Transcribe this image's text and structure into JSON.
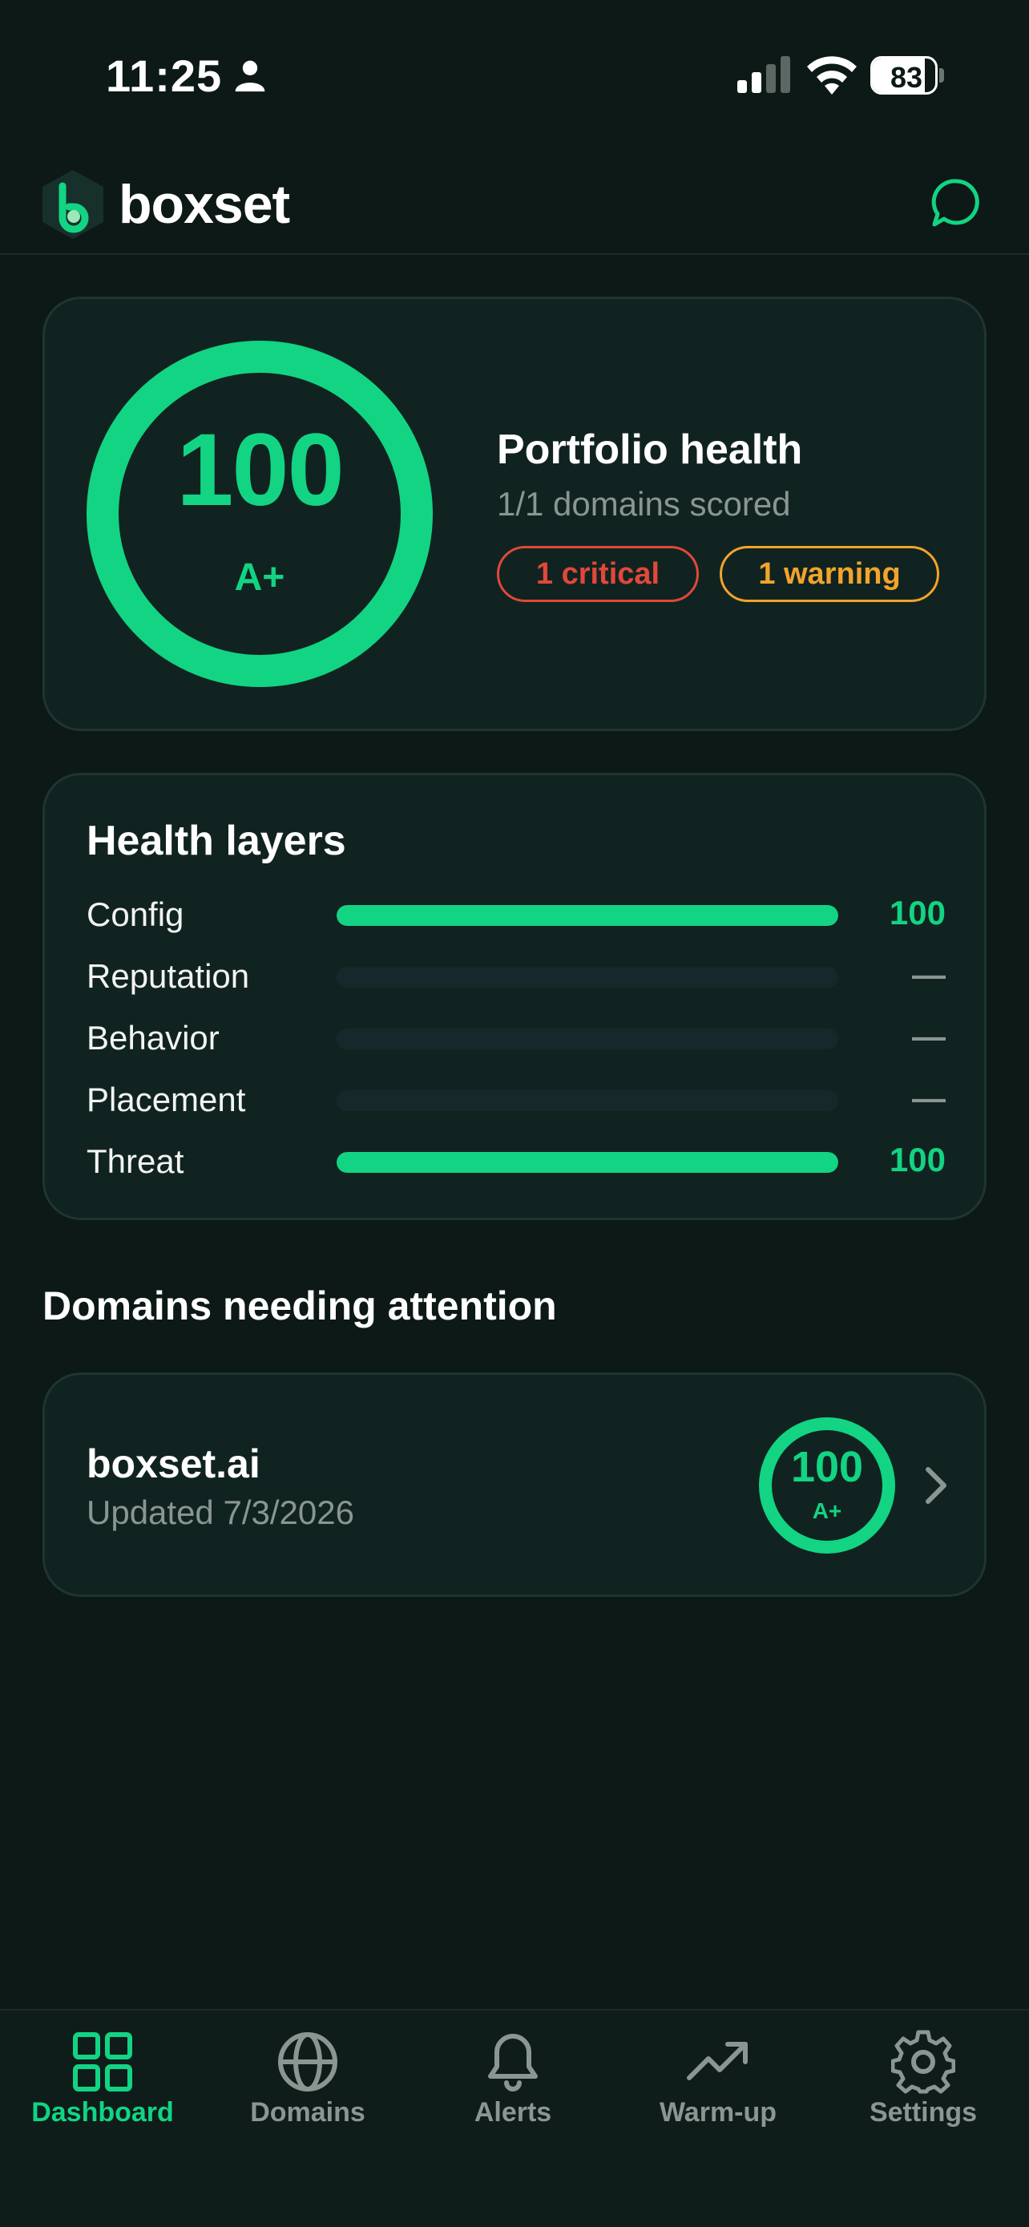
{
  "status_bar": {
    "time": "11:25",
    "battery_percent": "83",
    "battery_level": 0.83
  },
  "header": {
    "brand": "boxset",
    "chat_icon": "chat-bubble-icon",
    "logo_icon": "boxset-logo-icon"
  },
  "portfolio": {
    "score": "100",
    "grade": "A+",
    "title": "Portfolio health",
    "subtitle": "1/1 domains scored",
    "critical_label": "1 critical",
    "warning_label": "1 warning"
  },
  "layers": {
    "title": "Health layers",
    "items": [
      {
        "label": "Config",
        "value": "100",
        "fill": 1.0
      },
      {
        "label": "Reputation",
        "value": "—",
        "fill": 0
      },
      {
        "label": "Behavior",
        "value": "—",
        "fill": 0
      },
      {
        "label": "Placement",
        "value": "—",
        "fill": 0
      },
      {
        "label": "Threat",
        "value": "100",
        "fill": 1.0
      }
    ]
  },
  "attention": {
    "title": "Domains needing attention",
    "domains": [
      {
        "name": "boxset.ai",
        "updated": "Updated 7/3/2026",
        "score": "100",
        "grade": "A+"
      }
    ]
  },
  "tabs": [
    {
      "label": "Dashboard",
      "icon": "grid-icon",
      "active": true
    },
    {
      "label": "Domains",
      "icon": "globe-icon",
      "active": false
    },
    {
      "label": "Alerts",
      "icon": "bell-icon",
      "active": false
    },
    {
      "label": "Warm-up",
      "icon": "trending-up-icon",
      "active": false
    },
    {
      "label": "Settings",
      "icon": "gear-icon",
      "active": false
    }
  ],
  "colors": {
    "background": "#0c1917",
    "card": "#112320",
    "accent": "#12d483",
    "critical": "#e1483a",
    "warning": "#f2a42b",
    "muted": "#8a9692"
  }
}
